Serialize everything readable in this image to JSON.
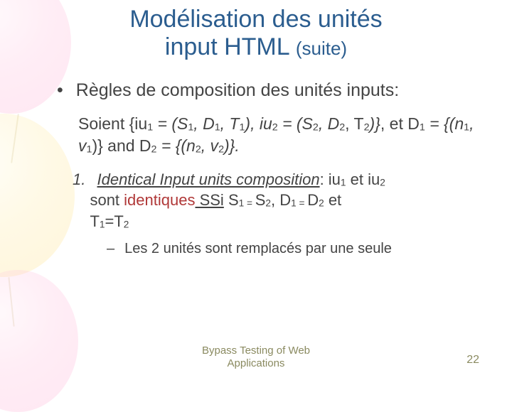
{
  "title_line1": "Modélisation des unités",
  "title_line2": "input HTML ",
  "title_suite": "(suite)",
  "bullet_text": "Règles de composition des unités inputs:",
  "formula": {
    "p1": "Soient {iu",
    "p2": " = (S",
    "p3": ", D",
    "p4": ", T",
    "p5": "), iu",
    "p6": " = (S",
    "p7": ", D",
    "p8": ", T",
    "p9": ")}",
    "p10": ", et D",
    "p11": " = {(n",
    "p12": ", v",
    "p13": ")} and D",
    "p14": " = {(n",
    "p15": ", v",
    "p16": ")}."
  },
  "rule1": {
    "num": "1.",
    "underlined": "Identical Input units composition",
    "colon": ": ",
    "iu_a": "iu",
    "et": " et ",
    "iu_b": "iu",
    "sont": "sont ",
    "ident": "identiques",
    "ssi": " SSi",
    "s": " S",
    "eq": " = ",
    "d": "D",
    "t": "T",
    "eq2": "=",
    "and": " et "
  },
  "subitem": "Les 2 unités sont remplacés par une seule",
  "footer_l1": "Bypass Testing of Web",
  "footer_l2": "Applications",
  "page": "22"
}
